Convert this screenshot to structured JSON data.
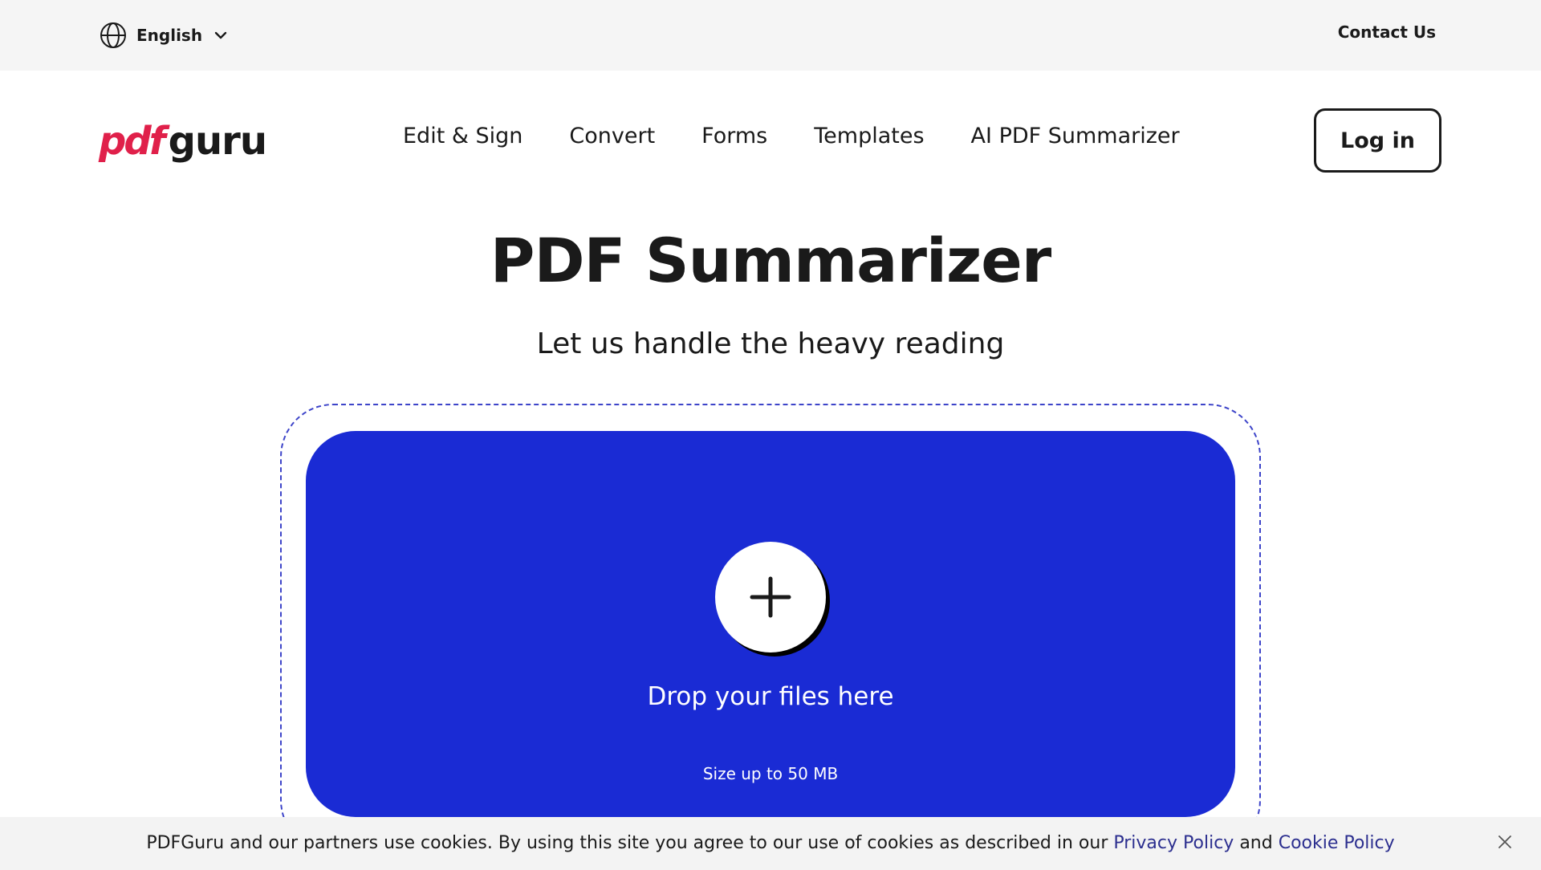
{
  "topbar": {
    "language": "English",
    "contact": "Contact Us"
  },
  "header": {
    "logo_pdf": "pdf",
    "logo_guru": "guru",
    "nav": [
      "Edit & Sign",
      "Convert",
      "Forms",
      "Templates",
      "AI PDF Summarizer"
    ],
    "login": "Log in"
  },
  "hero": {
    "title": "PDF Summarizer",
    "subtitle": "Let us handle the heavy reading"
  },
  "upload": {
    "drop_text": "Drop your files here",
    "size_text": "Size up to 50 MB"
  },
  "cookie": {
    "text_before": "PDFGuru and our partners use cookies. By using this site you agree to our use of cookies as described in our",
    "privacy_link": "Privacy Policy",
    "and": "and",
    "cookie_link": "Cookie Policy"
  },
  "colors": {
    "brand_red": "#e0204a",
    "dropzone_blue": "#1a2bd4",
    "link": "#2c2f8f"
  }
}
